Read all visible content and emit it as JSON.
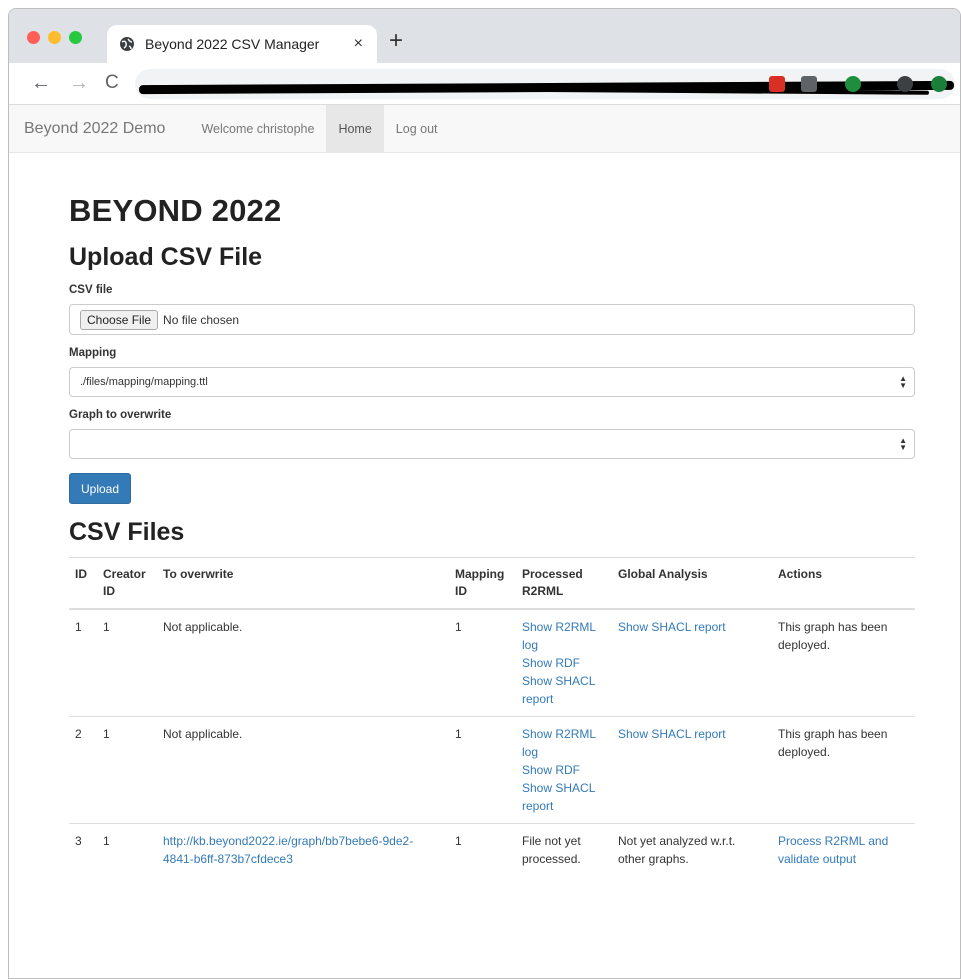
{
  "browser": {
    "tab_title": "Beyond 2022 CSV Manager",
    "tab_close": "×",
    "new_tab": "+",
    "icons": [
      "globe-icon",
      "back-arrow-icon",
      "forward-arrow-icon",
      "reload-icon"
    ]
  },
  "navbar": {
    "brand": "Beyond 2022 Demo",
    "welcome": "Welcome christophe",
    "home": "Home",
    "logout": "Log out"
  },
  "page": {
    "site_title": "BEYOND 2022",
    "upload_heading": "Upload CSV File",
    "csv_file_label": "CSV file",
    "choose_file_button": "Choose File",
    "no_file_text": "No file chosen",
    "mapping_label": "Mapping",
    "mapping_value": "./files/mapping/mapping.ttl",
    "graph_label": "Graph to overwrite",
    "graph_value": "",
    "upload_button": "Upload",
    "files_heading": "CSV Files"
  },
  "table": {
    "headers": {
      "id": "ID",
      "creator": "Creator ID",
      "overwrite": "To overwrite",
      "mapping": "Mapping ID",
      "processed": "Processed R2RML",
      "global": "Global Analysis",
      "actions": "Actions"
    },
    "rows": [
      {
        "id": "1",
        "creator": "1",
        "overwrite": "Not applicable.",
        "mapping": "1",
        "processed_links": [
          "Show R2RML log",
          "Show RDF",
          "Show SHACL report"
        ],
        "global": "Show SHACL report",
        "actions": "This graph has been deployed."
      },
      {
        "id": "2",
        "creator": "1",
        "overwrite": "Not applicable.",
        "mapping": "1",
        "processed_links": [
          "Show R2RML log",
          "Show RDF",
          "Show SHACL report"
        ],
        "global": "Show SHACL report",
        "actions": "This graph has been deployed."
      },
      {
        "id": "3",
        "creator": "1",
        "overwrite": "http://kb.beyond2022.ie/graph/bb7bebe6-9de2-4841-b6ff-873b7cfdece3",
        "mapping": "1",
        "processed": "File not yet processed.",
        "global": "Not yet analyzed w.r.t. other graphs.",
        "actions": "Process R2RML and validate output"
      }
    ]
  },
  "colors": {
    "link": "#337ab7",
    "button_primary": "#337ab7",
    "navbar_bg": "#f8f8f8"
  }
}
